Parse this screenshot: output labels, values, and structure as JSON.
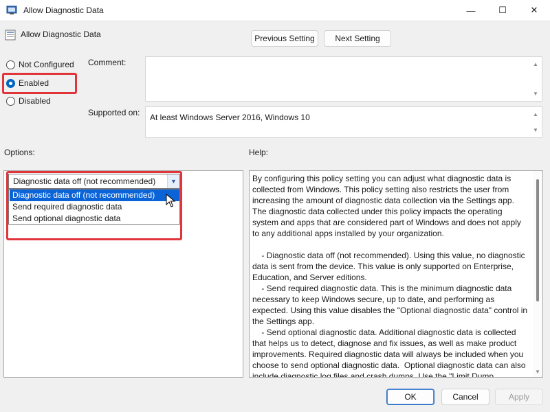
{
  "window": {
    "title": "Allow Diagnostic Data",
    "min_glyph": "—",
    "max_glyph": "☐",
    "close_glyph": "✕"
  },
  "policy": {
    "name": "Allow Diagnostic Data",
    "icon": "policy-setting-icon"
  },
  "nav": {
    "previous_label": "Previous Setting",
    "next_label": "Next Setting"
  },
  "state": {
    "options": [
      "Not Configured",
      "Enabled",
      "Disabled"
    ],
    "selected": "Enabled"
  },
  "comment": {
    "label": "Comment:",
    "value": ""
  },
  "supported": {
    "label": "Supported on:",
    "value": "At least Windows Server 2016, Windows 10"
  },
  "panels": {
    "options_label": "Options:",
    "help_label": "Help:"
  },
  "dropdown": {
    "selected": "Diagnostic data off (not recommended)",
    "items": [
      "Diagnostic data off (not recommended)",
      "Send required diagnostic data",
      "Send optional diagnostic data"
    ],
    "highlighted_index": 0
  },
  "help_text": "By configuring this policy setting you can adjust what diagnostic data is collected from Windows. This policy setting also restricts the user from increasing the amount of diagnostic data collection via the Settings app. The diagnostic data collected under this policy impacts the operating system and apps that are considered part of Windows and does not apply to any additional apps installed by your organization.\n\n    - Diagnostic data off (not recommended). Using this value, no diagnostic data is sent from the device. This value is only supported on Enterprise, Education, and Server editions.\n    - Send required diagnostic data. This is the minimum diagnostic data necessary to keep Windows secure, up to date, and performing as expected. Using this value disables the \"Optional diagnostic data\" control in the Settings app.\n    - Send optional diagnostic data. Additional diagnostic data is collected that helps us to detect, diagnose and fix issues, as well as make product improvements. Required diagnostic data will always be included when you choose to send optional diagnostic data.  Optional diagnostic data can also include diagnostic log files and crash dumps. Use the \"Limit Dump Collection\" and the \"Limit Diagnostic Log Collection\" policies for more granular control of",
  "footer": {
    "ok_label": "OK",
    "cancel_label": "Cancel",
    "apply_label": "Apply"
  },
  "colors": {
    "accent": "#0067c0",
    "highlight_box": "#e0353b",
    "selection": "#0a64d8"
  }
}
